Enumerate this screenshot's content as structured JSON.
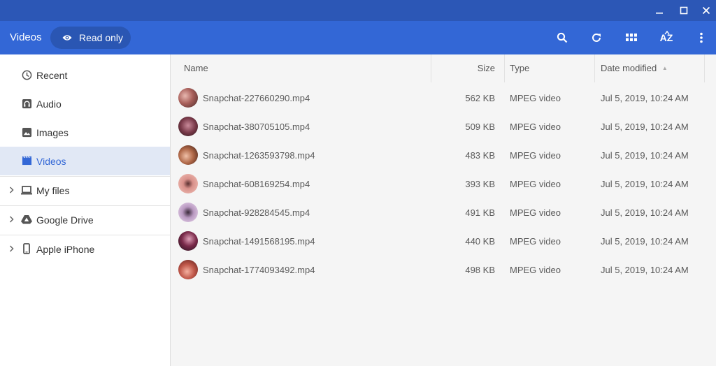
{
  "toolbar": {
    "title": "Videos",
    "readonly_label": "Read only",
    "icons": [
      "search-icon",
      "refresh-icon",
      "grid-view-icon",
      "sort-az-icon",
      "more-vert-icon"
    ],
    "sort_az_label": "AZ"
  },
  "window_controls": [
    "minimize-icon",
    "maximize-icon",
    "close-icon"
  ],
  "sidebar": {
    "items": [
      {
        "label": "Recent",
        "icon": "clock-icon",
        "active": false
      },
      {
        "label": "Audio",
        "icon": "audio-icon",
        "active": false
      },
      {
        "label": "Images",
        "icon": "image-icon",
        "active": false
      },
      {
        "label": "Videos",
        "icon": "video-icon",
        "active": true
      },
      {
        "label": "My files",
        "icon": "laptop-icon",
        "expandable": true
      },
      {
        "label": "Google Drive",
        "icon": "drive-icon",
        "expandable": true
      },
      {
        "label": "Apple iPhone",
        "icon": "phone-icon",
        "expandable": true
      }
    ]
  },
  "columns": {
    "name": "Name",
    "size": "Size",
    "type": "Type",
    "date": "Date modified",
    "sort_indicator": "▲"
  },
  "files": [
    {
      "name": "Snapchat-227660290.mp4",
      "size": "562 KB",
      "type": "MPEG video",
      "date": "Jul 5, 2019, 10:24 AM"
    },
    {
      "name": "Snapchat-380705105.mp4",
      "size": "509 KB",
      "type": "MPEG video",
      "date": "Jul 5, 2019, 10:24 AM"
    },
    {
      "name": "Snapchat-1263593798.mp4",
      "size": "483 KB",
      "type": "MPEG video",
      "date": "Jul 5, 2019, 10:24 AM"
    },
    {
      "name": "Snapchat-608169254.mp4",
      "size": "393 KB",
      "type": "MPEG video",
      "date": "Jul 5, 2019, 10:24 AM"
    },
    {
      "name": "Snapchat-928284545.mp4",
      "size": "491 KB",
      "type": "MPEG video",
      "date": "Jul 5, 2019, 10:24 AM"
    },
    {
      "name": "Snapchat-1491568195.mp4",
      "size": "440 KB",
      "type": "MPEG video",
      "date": "Jul 5, 2019, 10:24 AM"
    },
    {
      "name": "Snapchat-1774093492.mp4",
      "size": "498 KB",
      "type": "MPEG video",
      "date": "Jul 5, 2019, 10:24 AM"
    }
  ],
  "colors": {
    "titlebar": "#2c57b6",
    "toolbar": "#3367d6",
    "accent": "#3367d6",
    "active_nav_bg": "#e1e8f5"
  }
}
